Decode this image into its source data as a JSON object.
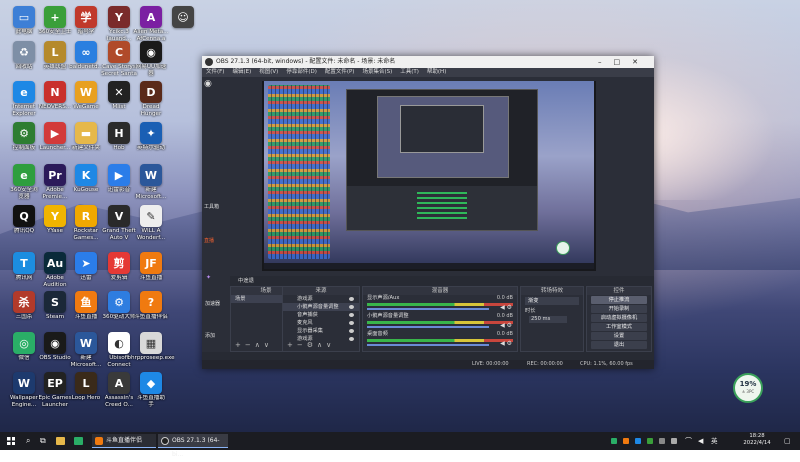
{
  "desktop": {
    "columns": [
      [
        {
          "label": "此电脑",
          "icon": "computer-icon",
          "color": "#3d7fd6",
          "glyph": "▭"
        },
        {
          "label": "回收站",
          "icon": "recycle-bin-icon",
          "color": "#7e8fa6",
          "glyph": "♻"
        },
        {
          "label": "Internet\nExplorer",
          "icon": "ie-icon",
          "color": "#1e88e5",
          "glyph": "e"
        },
        {
          "label": "控制面板",
          "icon": "control-panel-icon",
          "color": "#2e7d32",
          "glyph": "⚙"
        },
        {
          "label": "360安全浏\n览器",
          "icon": "360-browser-icon",
          "color": "#2e9e3e",
          "glyph": "e"
        },
        {
          "label": "腾讯QQ",
          "icon": "qq-icon",
          "color": "#111",
          "glyph": "Q"
        },
        {
          "label": "腾讯网",
          "icon": "tencent-icon",
          "color": "#1c8de0",
          "glyph": "T"
        },
        {
          "label": "三国杀",
          "icon": "sanguosha-icon",
          "color": "#b23a2a",
          "glyph": "杀"
        },
        {
          "label": "微信",
          "icon": "wechat-icon",
          "color": "#2aae67",
          "glyph": "◎"
        },
        {
          "label": "Wallpaper\nEngine...",
          "icon": "wallpaper-engine-icon",
          "color": "#1d3a6e",
          "glyph": "W"
        }
      ],
      [
        {
          "label": "360安全卫士",
          "icon": "360-guard-icon",
          "color": "#3a9f3a",
          "glyph": "+"
        },
        {
          "label": "英雄联盟",
          "icon": "lol-icon",
          "color": "#b58a2c",
          "glyph": "L"
        },
        {
          "label": "NEOVERS...",
          "icon": "neovers-icon",
          "color": "#c9302c",
          "glyph": "N"
        },
        {
          "label": "Launcher...",
          "icon": "launcher-icon",
          "color": "#d23a3a",
          "glyph": "▶"
        },
        {
          "label": "Adobe\nPremie...",
          "icon": "premiere-icon",
          "color": "#2b1a5a",
          "glyph": "Pr"
        },
        {
          "label": "YYase",
          "icon": "yy-icon",
          "color": "#f0b400",
          "glyph": "Y"
        },
        {
          "label": "Adobe\nAudition",
          "icon": "audition-icon",
          "color": "#0a2a3a",
          "glyph": "Au"
        },
        {
          "label": "Steam",
          "icon": "steam-icon",
          "color": "#1b2838",
          "glyph": "S"
        },
        {
          "label": "OBS Studio",
          "icon": "obs-icon",
          "color": "#1a1a1a",
          "glyph": "◉"
        },
        {
          "label": "Epic Games\nLauncher",
          "icon": "epic-icon",
          "color": "#222",
          "glyph": "EP"
        }
      ],
      [
        {
          "label": "暗号学",
          "icon": "anhao-icon",
          "color": "#c0392b",
          "glyph": "学"
        },
        {
          "label": "baidunetd...",
          "icon": "baidu-netdisk-icon",
          "color": "#2a7fe0",
          "glyph": "∞"
        },
        {
          "label": "WeGame",
          "icon": "wegame-icon",
          "color": "#e8a020",
          "glyph": "W"
        },
        {
          "label": "新建文件夹",
          "icon": "folder-icon",
          "color": "#e6b84a",
          "glyph": "▬"
        },
        {
          "label": "KuGouse",
          "icon": "kugou-icon",
          "color": "#1e88e5",
          "glyph": "K"
        },
        {
          "label": "Rockstar\nGames...",
          "icon": "rockstar-icon",
          "color": "#f0a800",
          "glyph": "R"
        },
        {
          "label": "迅雷",
          "icon": "xunlei-icon",
          "color": "#2b7de9",
          "glyph": "➤"
        },
        {
          "label": "斗鱼直播",
          "icon": "douyu-icon",
          "color": "#f07a10",
          "glyph": "鱼"
        },
        {
          "label": "新建\nMicrosoft...",
          "icon": "word-icon",
          "color": "#2b579a",
          "glyph": "W"
        },
        {
          "label": "Loop Hero",
          "icon": "loop-hero-icon",
          "color": "#3a2a1a",
          "glyph": "L"
        }
      ],
      [
        {
          "label": "Ycikc.3\nlauand...",
          "icon": "game-icon-1",
          "color": "#7a2b2b",
          "glyph": "Y"
        },
        {
          "label": "Cave Storys\nSecret Santa",
          "icon": "cave-story-icon",
          "color": "#b04a2a",
          "glyph": "C"
        },
        {
          "label": "Mlist",
          "icon": "mlist-icon",
          "color": "#222",
          "glyph": "✕"
        },
        {
          "label": "Hob",
          "icon": "hob-icon",
          "color": "#2b2b2b",
          "glyph": "H"
        },
        {
          "label": "迅雷影音",
          "icon": "xunlei-player-icon",
          "color": "#2b7de9",
          "glyph": "▶"
        },
        {
          "label": "Grand Theft\nAuto V",
          "icon": "gta-icon",
          "color": "#2a2a2a",
          "glyph": "V"
        },
        {
          "label": "爱剪辑",
          "icon": "aijianji-icon",
          "color": "#e53935",
          "glyph": "剪"
        },
        {
          "label": "360驱动大师",
          "icon": "360-driver-icon",
          "color": "#2e7de0",
          "glyph": "⚙"
        },
        {
          "label": "Ubisoft\nConnect",
          "icon": "ubisoft-icon",
          "color": "#fff",
          "glyph": "◐"
        },
        {
          "label": "Assassin's\nCreed O...",
          "icon": "assassins-creed-icon",
          "color": "#3a3a3a",
          "glyph": "A"
        }
      ],
      [
        {
          "label": "Alien Meta...\nAfCenna.a",
          "icon": "alien-icon",
          "color": "#7b1fa2",
          "glyph": "A"
        },
        {
          "label": "网易UU加速\n器",
          "icon": "uu-icon",
          "color": "#1a1a1a",
          "glyph": "◉"
        },
        {
          "label": "Dread\nHunger",
          "icon": "dread-hunger-icon",
          "color": "#5a2a1a",
          "glyph": "D"
        },
        {
          "label": "英特尔驱动",
          "icon": "intel-icon",
          "color": "#1a5fb4",
          "glyph": "✦"
        },
        {
          "label": "新建\nMicrosoft...",
          "icon": "word-icon-2",
          "color": "#2b579a",
          "glyph": "W"
        },
        {
          "label": "WILL A\nWonderf...",
          "icon": "will-icon",
          "color": "#eee",
          "glyph": "✎"
        },
        {
          "label": "斗鱼直播",
          "icon": "douyu-icon-2",
          "color": "#f07a10",
          "glyph": "JF"
        },
        {
          "label": "斗鱼直播伴侣",
          "icon": "douyu-companion-icon",
          "color": "#f07a10",
          "glyph": "?"
        },
        {
          "label": "bhrpproseep.exe",
          "icon": "exe-icon",
          "color": "#d8d8d8",
          "glyph": "▦"
        },
        {
          "label": "斗鱼直播助\n手",
          "icon": "douyu-assistant-icon",
          "color": "#1e88e5",
          "glyph": "◆"
        }
      ],
      [
        {
          "label": "",
          "icon": "steam-deck-icon",
          "color": "#444",
          "glyph": "☺"
        }
      ]
    ]
  },
  "obs": {
    "title": "OBS 27.1.3 (64-bit, windows) - 配置文件: 未命名 - 场景: 未命名",
    "menu": [
      "文件(F)",
      "编辑(E)",
      "视图(V)",
      "停靠部件(D)",
      "配置文件(P)",
      "场景集合(S)",
      "工具(T)",
      "帮助(H)"
    ],
    "left_tabs": [
      "工具箱",
      "直播"
    ],
    "left_strip_labels": [
      "中途退",
      "场景",
      "源",
      "加速器",
      "添加"
    ],
    "scenes_header": "场景",
    "scenes": [
      "场景"
    ],
    "sources_header": "来源",
    "sources": [
      "游戏源",
      "小鹅声源音量调整",
      "音声捕获",
      "麦克风",
      "显示器采集",
      "游戏源"
    ],
    "mixer_header": "混音器",
    "mixer_tracks": [
      {
        "name": "显示声源/Aux",
        "db": "0.0 dB"
      },
      {
        "name": "小鹅声源音量调整",
        "db": "0.0 dB"
      },
      {
        "name": "桌面音频",
        "db": "0.0 dB"
      }
    ],
    "transitions_header": "转场特效",
    "transition_type": "渐变",
    "transition_duration_label": "时长",
    "transition_duration": "250 ms",
    "controls_header": "控件",
    "controls": [
      "停止推流",
      "开始录制",
      "启动虚拟摄像机",
      "工作室模式",
      "设置",
      "退出"
    ],
    "status": {
      "lv": "LIVE: 00:00:00",
      "rec": "REC: 00:00:00",
      "cpu": "CPU: 1.1%, 60.00 fps"
    },
    "preview_badge": "●"
  },
  "widget": {
    "percent": "19%",
    "sub": "± 3PC"
  },
  "taskbar": {
    "apps": [
      {
        "label": "斗鱼直播伴侣",
        "icon": "douyu-taskbar-icon"
      },
      {
        "label": "OBS 27.1.3 (64-bi...",
        "icon": "obs-taskbar-icon"
      }
    ],
    "clock_time": "18:28",
    "clock_date": "2022/4/14",
    "lang": "英"
  }
}
